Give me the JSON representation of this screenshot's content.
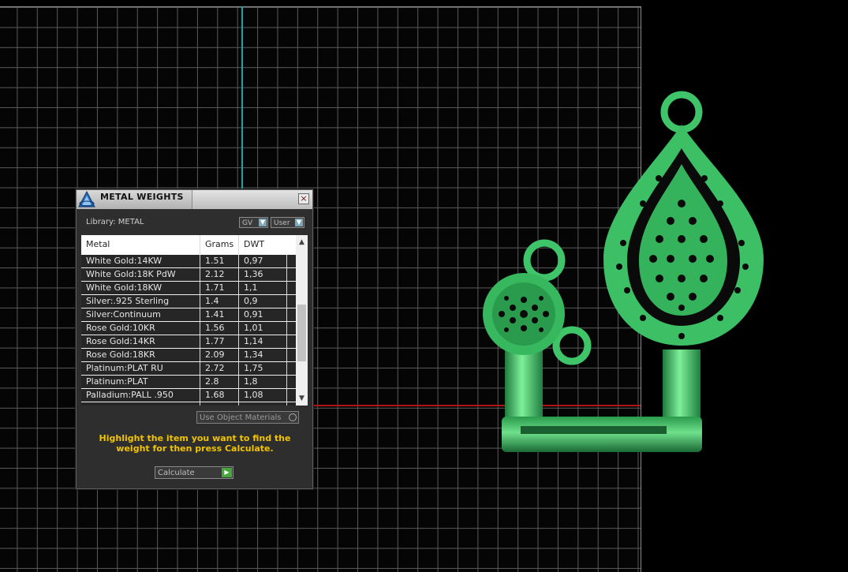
{
  "dialog": {
    "title": "METAL WEIGHTS",
    "close_label": "×",
    "library_label": "Library: METAL",
    "gv_select": "GV",
    "user_select": "User",
    "columns": [
      "Metal",
      "Grams",
      "DWT"
    ],
    "rows": [
      {
        "metal": "White Gold:14KW",
        "grams": "1.51",
        "dwt": "0,97"
      },
      {
        "metal": "White Gold:18K PdW",
        "grams": "2.12",
        "dwt": "1,36"
      },
      {
        "metal": "White Gold:18KW",
        "grams": "1.71",
        "dwt": "1,1"
      },
      {
        "metal": "Silver:.925 Sterling",
        "grams": "1.4",
        "dwt": "0,9"
      },
      {
        "metal": "Silver:Continuum",
        "grams": "1.41",
        "dwt": "0,91"
      },
      {
        "metal": "Rose Gold:10KR",
        "grams": "1.56",
        "dwt": "1,01"
      },
      {
        "metal": "Rose Gold:14KR",
        "grams": "1.77",
        "dwt": "1,14"
      },
      {
        "metal": "Rose Gold:18KR",
        "grams": "2.09",
        "dwt": "1,34"
      },
      {
        "metal": "Platinum:PLAT RU",
        "grams": "2.72",
        "dwt": "1,75"
      },
      {
        "metal": "Platinum:PLAT",
        "grams": "2.8",
        "dwt": "1,8"
      },
      {
        "metal": "Palladium:PALL .950",
        "grams": "1.68",
        "dwt": "1,08"
      },
      {
        "metal": "",
        "grams": "",
        "dwt": ""
      }
    ],
    "use_object_materials": "Use Object Materials",
    "instruction": "Highlight the item you want to find the weight for then press Calculate.",
    "calculate_label": "Calculate"
  },
  "colors": {
    "model_green": "#3fc46a",
    "instruction_yellow": "#f2c400",
    "axis_x": "#b01414",
    "axis_y": "#18a6a0"
  }
}
